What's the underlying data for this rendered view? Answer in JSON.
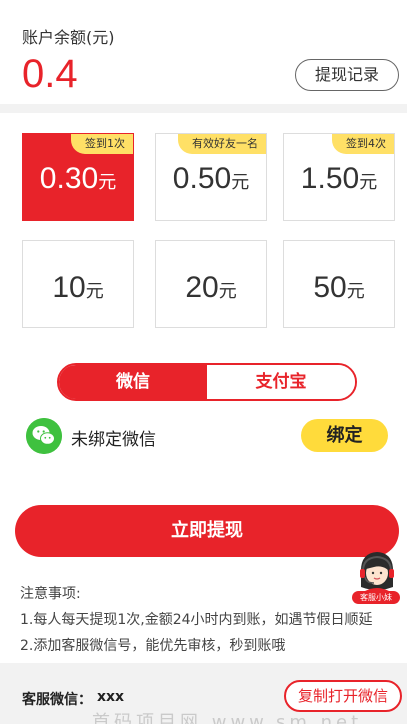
{
  "balance": {
    "label": "账户余额(元)",
    "value": "0.4",
    "history_button": "提现记录"
  },
  "amounts": [
    {
      "value": "0.30",
      "unit": "元",
      "tag": "签到1次",
      "selected": true
    },
    {
      "value": "0.50",
      "unit": "元",
      "tag": "有效好友一名",
      "selected": false
    },
    {
      "value": "1.50",
      "unit": "元",
      "tag": "签到4次",
      "selected": false
    },
    {
      "value": "10",
      "unit": "元",
      "tag": "",
      "selected": false
    },
    {
      "value": "20",
      "unit": "元",
      "tag": "",
      "selected": false
    },
    {
      "value": "50",
      "unit": "元",
      "tag": "",
      "selected": false
    }
  ],
  "payment_tabs": [
    {
      "label": "微信",
      "active": true
    },
    {
      "label": "支付宝",
      "active": false
    }
  ],
  "wechat_bind": {
    "icon": "wechat-icon",
    "status": "未绑定微信",
    "bind_button": "绑定"
  },
  "withdraw_button": "立即提现",
  "customer_service_badge": "客服小妹",
  "notes": {
    "title": "注意事项:",
    "items": [
      "1.每人每天提现1次,金额24小时内到账，如遇节假日顺延",
      "2.添加客服微信号，能优先审核，秒到账哦"
    ]
  },
  "footer": {
    "label": "客服微信：",
    "value": "xxx",
    "copy_button": "复制打开微信",
    "watermark": "首码项目网 www.sm.net"
  },
  "colors": {
    "accent": "#e8232a",
    "tag": "#ffe066",
    "bind": "#ffdb3b",
    "wechat": "#3fc13f"
  }
}
